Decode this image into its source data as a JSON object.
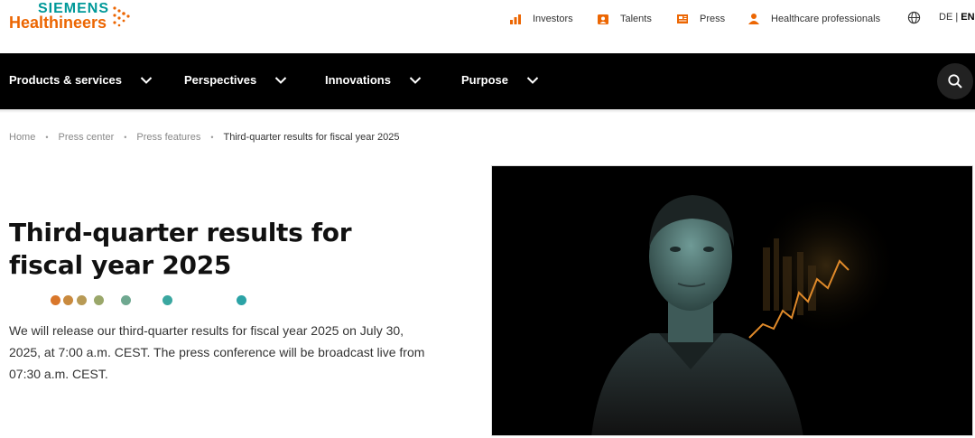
{
  "brand": {
    "siemens": "SIEMENS",
    "healthineers": "Healthineers"
  },
  "utility_nav": {
    "investors": "Investors",
    "talents": "Talents",
    "press": "Press",
    "healthcare": "Healthcare professionals",
    "lang_de": "DE",
    "lang_sep": " | ",
    "lang_en": "EN"
  },
  "main_nav": [
    {
      "label": "Products & services"
    },
    {
      "label": "Perspectives"
    },
    {
      "label": "Innovations"
    },
    {
      "label": "Purpose"
    }
  ],
  "breadcrumb": {
    "home": "Home",
    "press_center": "Press center",
    "press_features": "Press features",
    "current": "Third-quarter results for fiscal year 2025"
  },
  "article": {
    "title": "Third-quarter results for fiscal year 2025",
    "lead": "We will release our third-quarter results for fiscal year 2025 on July 30, 2025, at 7:00 a.m. CEST. The press conference will be broadcast live from 07:30 a.m. CEST."
  },
  "colors": {
    "brand_orange": "#ec6602",
    "brand_teal": "#009999",
    "nav_bg": "#000000",
    "decor_dots": [
      "#d9772b",
      "#c98a3e",
      "#b89a55",
      "#9aa76a",
      "#6fa890",
      "#3aa7a0",
      "#2ba3a6"
    ]
  },
  "icons": {
    "investors": "chart-icon",
    "talents": "badge-icon",
    "press": "newspaper-icon",
    "healthcare": "person-icon",
    "globe": "globe-icon",
    "search": "search-icon",
    "chevron": "chevron-down-icon"
  }
}
